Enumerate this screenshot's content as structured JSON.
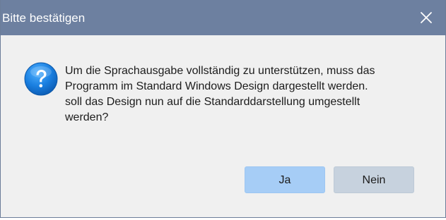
{
  "dialog": {
    "title": "Bitte bestätigen",
    "close_icon": "close-icon",
    "icon": "question-icon",
    "message_lines": [
      "Um die Sprachausgabe vollständig zu unterstützen, muss das",
      "Programm im Standard Windows Design dargestellt werden.",
      "soll das Design nun auf die Standarddarstellung umgestellt",
      "werden?"
    ],
    "buttons": {
      "yes_label": "Ja",
      "no_label": "Nein"
    }
  },
  "colors": {
    "title_bar": "#6d80a0",
    "body": "#f0f0f0",
    "yes_button": "#a6cdf6",
    "no_button": "#c7d2de",
    "icon_blue": "#1a7fe0"
  }
}
